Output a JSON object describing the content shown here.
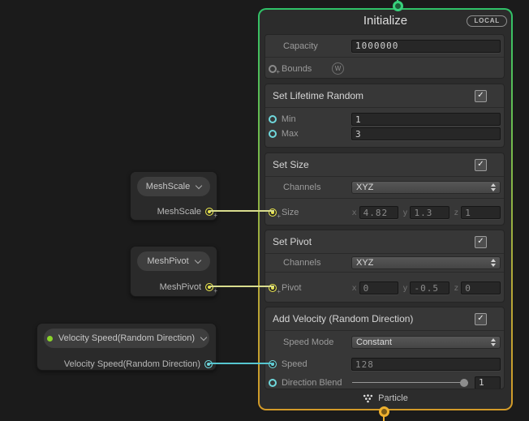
{
  "ui": {
    "plus": "+",
    "check": "✓",
    "vx": "x",
    "vy": "y",
    "vz": "z"
  },
  "context": {
    "title": "Initialize",
    "space_badge": "LOCAL",
    "settings": {
      "capacity": {
        "label": "Capacity",
        "value": "1000000"
      },
      "bounds": {
        "label": "Bounds",
        "badge": "W"
      }
    },
    "blocks": {
      "lifetime": {
        "title": "Set Lifetime Random",
        "min": {
          "label": "Min",
          "value": "1"
        },
        "max": {
          "label": "Max",
          "value": "3"
        }
      },
      "size": {
        "title": "Set Size",
        "channels": {
          "label": "Channels",
          "value": "XYZ"
        },
        "size": {
          "label": "Size",
          "x": "4.82",
          "y": "1.3",
          "z": "1"
        }
      },
      "pivot": {
        "title": "Set Pivot",
        "channels": {
          "label": "Channels",
          "value": "XYZ"
        },
        "pivot": {
          "label": "Pivot",
          "x": "0",
          "y": "-0.5",
          "z": "0"
        }
      },
      "velocity": {
        "title": "Add Velocity (Random Direction)",
        "speed_mode": {
          "label": "Speed Mode",
          "value": "Constant"
        },
        "speed": {
          "label": "Speed",
          "value": "128"
        },
        "direction_blend": {
          "label": "Direction Blend",
          "value": "1"
        }
      }
    },
    "footer": {
      "label": "Particle"
    }
  },
  "operators": {
    "mesh_scale": {
      "title": "MeshScale",
      "output": "MeshScale"
    },
    "mesh_pivot": {
      "title": "MeshPivot",
      "output": "MeshPivot"
    },
    "velocity_speed": {
      "title": "Velocity Speed(Random Direction)",
      "output": "Velocity Speed(Random Direction)"
    }
  },
  "colors": {
    "canvas_bg": "#1b1b1b",
    "edge_vector": "#d9dd8e",
    "edge_float": "#56c6d0",
    "port_vector": "#e8e44e",
    "port_float": "#6fd8dc",
    "flow_in": "#38d17c",
    "flow_out": "#eeb02e",
    "exposed_dot": "#8ad42a"
  }
}
